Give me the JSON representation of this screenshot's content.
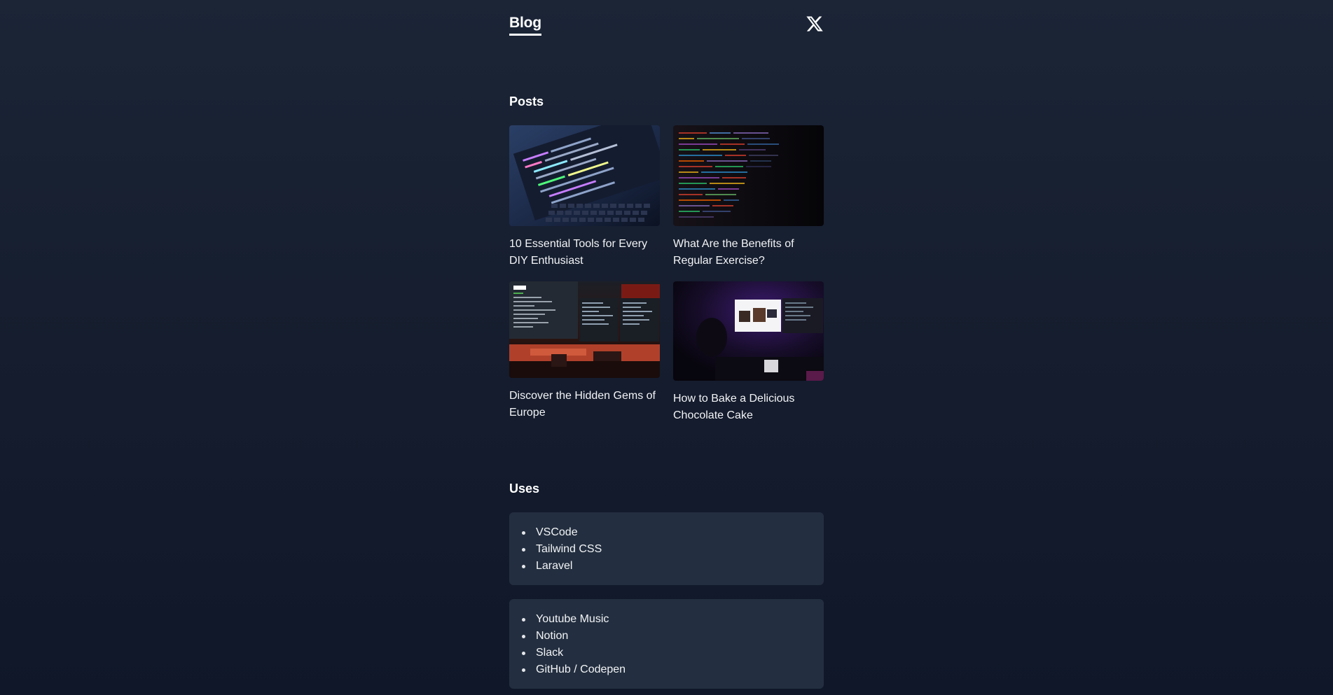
{
  "header": {
    "brand": "Blog",
    "x_icon": "x-logo-icon"
  },
  "posts": {
    "heading": "Posts",
    "items": [
      {
        "title": "10 Essential Tools for Every DIY Enthusiast",
        "image": "laptop-code-photo"
      },
      {
        "title": "What Are the Benefits of Regular Exercise?",
        "image": "code-screen-photo"
      },
      {
        "title": "Discover the Hidden Gems of Europe",
        "image": "monitors-setup-photo"
      },
      {
        "title": "How to Bake a Delicious Chocolate Cake",
        "image": "dark-room-desk-photo"
      }
    ]
  },
  "uses": {
    "heading": "Uses",
    "groups": [
      {
        "items": [
          "VSCode",
          "Tailwind CSS",
          "Laravel"
        ]
      },
      {
        "items": [
          "Youtube Music",
          "Notion",
          "Slack",
          "GitHub / Codepen"
        ]
      }
    ]
  },
  "colors": {
    "background_top": "#1b2536",
    "background_bottom": "#0f1729",
    "card_bg": "#232f40",
    "text": "#f3f4f6"
  }
}
